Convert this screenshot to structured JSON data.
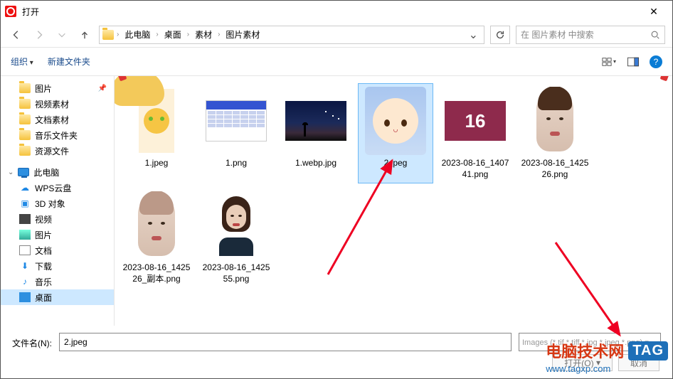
{
  "window": {
    "title": "打开"
  },
  "nav": {
    "crumbs": [
      "此电脑",
      "桌面",
      "素材",
      "图片素材"
    ],
    "search_placeholder": "在 图片素材 中搜索"
  },
  "toolbar": {
    "organize": "组织",
    "new_folder": "新建文件夹",
    "help": "?"
  },
  "sidebar": {
    "pinned": [
      {
        "label": "图片",
        "icon": "folder"
      },
      {
        "label": "视频素材",
        "icon": "folder"
      },
      {
        "label": "文档素材",
        "icon": "folder"
      },
      {
        "label": "音乐文件夹",
        "icon": "folder"
      },
      {
        "label": "资源文件",
        "icon": "folder"
      }
    ],
    "root_label": "此电脑",
    "children": [
      {
        "label": "WPS云盘",
        "icon": "cloud"
      },
      {
        "label": "3D 对象",
        "icon": "cube"
      },
      {
        "label": "视频",
        "icon": "video"
      },
      {
        "label": "图片",
        "icon": "pic"
      },
      {
        "label": "文档",
        "icon": "doc"
      },
      {
        "label": "下载",
        "icon": "down"
      },
      {
        "label": "音乐",
        "icon": "music"
      },
      {
        "label": "桌面",
        "icon": "desk",
        "selected": true
      }
    ]
  },
  "files": [
    {
      "name": "1.jpeg",
      "thumb": "yellow"
    },
    {
      "name": "1.png",
      "thumb": "cal"
    },
    {
      "name": "1.webp.jpg",
      "thumb": "night"
    },
    {
      "name": "2.jpeg",
      "thumb": "girl",
      "selected": true
    },
    {
      "name": "2023-08-16_140741.png",
      "thumb": "sixteen",
      "badge": "16"
    },
    {
      "name": "2023-08-16_142526.png",
      "thumb": "face"
    },
    {
      "name": "2023-08-16_142526_副本.png",
      "thumb": "faceblur"
    },
    {
      "name": "2023-08-16_142555.png",
      "thumb": "woman"
    }
  ],
  "footer": {
    "filename_label": "文件名(N):",
    "filename_value": "2.jpeg",
    "filter_text": "Images (*.tif *.tiff *.jpg *.jpeg *.png) ▾",
    "open": "打开(O)",
    "cancel": "取消"
  },
  "watermark": {
    "text": "电脑技术网",
    "tag": "TAG",
    "url": "www.tagxp.com"
  }
}
